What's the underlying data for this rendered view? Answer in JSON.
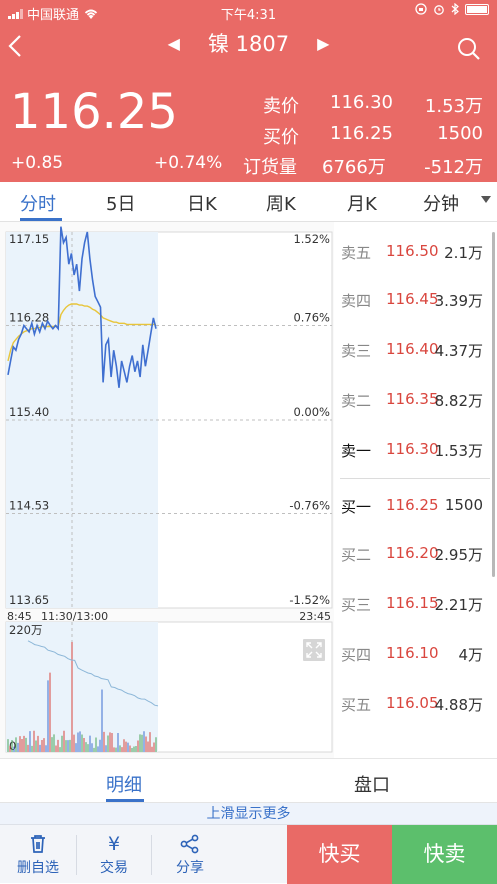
{
  "status": {
    "carrier": "中国联通",
    "time": "下午4:31"
  },
  "header": {
    "instrument": "镍 1807",
    "price": "116.25",
    "change": "+0.85",
    "change_pct": "+0.74%",
    "ask_label": "卖价",
    "ask_price": "116.30",
    "ask_vol": "1.53万",
    "bid_label": "买价",
    "bid_price": "116.25",
    "bid_vol": "1500",
    "oi_label": "订货量",
    "oi_value": "6766万",
    "oi_change": "-512万"
  },
  "tabs": [
    "分时",
    "5日",
    "日K",
    "周K",
    "月K",
    "分钟"
  ],
  "chart_data": {
    "type": "line",
    "title": "",
    "y_left_ticks": [
      "117.15",
      "116.28",
      "115.40",
      "114.53",
      "113.65"
    ],
    "y_right_ticks": [
      "1.52%",
      "0.76%",
      "0.00%",
      "-0.76%",
      "-1.52%"
    ],
    "x_ticks": [
      "8:45",
      "11:30/13:00",
      "23:45"
    ],
    "ylim": [
      113.65,
      117.15
    ],
    "prev_close": 115.4,
    "series": [
      {
        "values": [
          115.82,
          115.95,
          116.08,
          116.05,
          116.15,
          116.2,
          116.28,
          116.25,
          116.22,
          116.3,
          116.2,
          116.28,
          116.22,
          116.3,
          116.25,
          116.32,
          116.28,
          116.25,
          116.28,
          116.25,
          117.2,
          117.05,
          117.1,
          116.85,
          116.95,
          116.75,
          116.85,
          116.6,
          116.9,
          117.05,
          117.15,
          116.9,
          116.7,
          116.55,
          116.5,
          116.45,
          115.75,
          116.1,
          116.15,
          115.8,
          116.05,
          115.9,
          115.7,
          115.95,
          115.85,
          115.75,
          115.9,
          116.0,
          115.85,
          115.95,
          115.8,
          116.1,
          115.9,
          116.05,
          116.2,
          116.35,
          116.25
        ]
      },
      {
        "values": [
          115.95,
          116.05,
          116.12,
          116.15,
          116.18,
          116.2,
          116.22,
          116.23,
          116.24,
          116.25,
          116.25,
          116.26,
          116.26,
          116.27,
          116.27,
          116.27,
          116.27,
          116.27,
          116.27,
          116.27,
          116.38,
          116.42,
          116.45,
          116.47,
          116.48,
          116.48,
          116.48,
          116.47,
          116.47,
          116.46,
          116.46,
          116.45,
          116.43,
          116.42,
          116.4,
          116.38,
          116.35,
          116.34,
          116.33,
          116.32,
          116.31,
          116.31,
          116.3,
          116.3,
          116.3,
          116.29,
          116.29,
          116.29,
          116.29,
          116.29,
          116.29,
          116.29,
          116.29,
          116.29,
          116.29,
          116.29,
          116.29
        ]
      }
    ],
    "volume": {
      "max_label": "220万",
      "zero_label": "0"
    }
  },
  "order_book": {
    "asks": [
      {
        "label": "卖五",
        "price": "116.50",
        "vol": "2.1万"
      },
      {
        "label": "卖四",
        "price": "116.45",
        "vol": "3.39万"
      },
      {
        "label": "卖三",
        "price": "116.40",
        "vol": "4.37万"
      },
      {
        "label": "卖二",
        "price": "116.35",
        "vol": "8.82万"
      },
      {
        "label": "卖一",
        "price": "116.30",
        "vol": "1.53万"
      }
    ],
    "bids": [
      {
        "label": "买一",
        "price": "116.25",
        "vol": "1500"
      },
      {
        "label": "买二",
        "price": "116.20",
        "vol": "2.95万"
      },
      {
        "label": "买三",
        "price": "116.15",
        "vol": "2.21万"
      },
      {
        "label": "买四",
        "price": "116.10",
        "vol": "4万"
      },
      {
        "label": "买五",
        "price": "116.05",
        "vol": "4.88万"
      }
    ]
  },
  "detail_tabs": [
    "明细",
    "盘口"
  ],
  "swipe_hint": "上滑显示更多",
  "bottom": {
    "delete_label": "删自选",
    "trade_icon": "¥",
    "trade_label": "交易",
    "share_label": "分享",
    "buy_label": "快买",
    "sell_label": "快卖"
  },
  "colors": {
    "header_red": "#e96a66",
    "accent_blue": "#3a72c9",
    "price_line": "#3f6fd0",
    "avg_line": "#e8c53a",
    "sell_green": "#5cbf6c"
  }
}
